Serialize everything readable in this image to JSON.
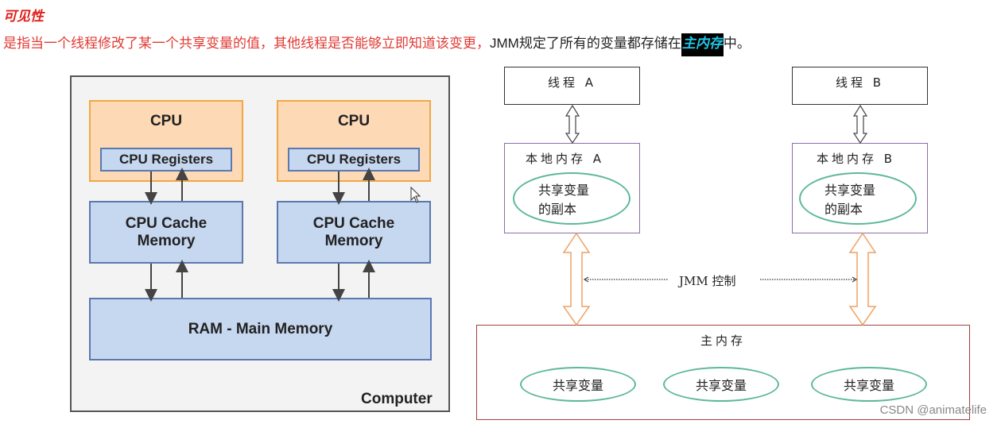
{
  "heading": "可见性",
  "description": {
    "part_red": "是指当一个线程修改了某一个共享变量的值，其他线程是否能够立即知道该变更，",
    "part_black_1": "JMM规定了所有的变量都存储在",
    "highlight": "主内存",
    "part_black_2": "中。"
  },
  "computer_diagram": {
    "cpu_label": "CPU",
    "registers_label": "CPU Registers",
    "cache_label_line1": "CPU Cache",
    "cache_label_line2": "Memory",
    "ram_label": "RAM - Main Memory",
    "computer_label": "Computer"
  },
  "jmm_diagram": {
    "thread_a": "线程 A",
    "thread_b": "线程 B",
    "local_memory_a": "本地内存 A",
    "local_memory_b": "本地内存 B",
    "copy_line1": "共享变量",
    "copy_line2": "的副本",
    "jmm_control": "JMM 控制",
    "main_memory": "主内存",
    "shared_variables": [
      "共享变量",
      "共享变量",
      "共享变量"
    ]
  },
  "colors": {
    "heading_red": "#e0201c",
    "cpu_fill": "#fdd9b5",
    "cpu_border": "#f0a846",
    "memory_fill": "#c6d7f0",
    "memory_border": "#5b79ad",
    "highlight_text": "#1fc7e6",
    "ellipse_green": "#5eb89a",
    "arrow_orange": "#f0a060"
  },
  "watermark": "CSDN @animatelife"
}
